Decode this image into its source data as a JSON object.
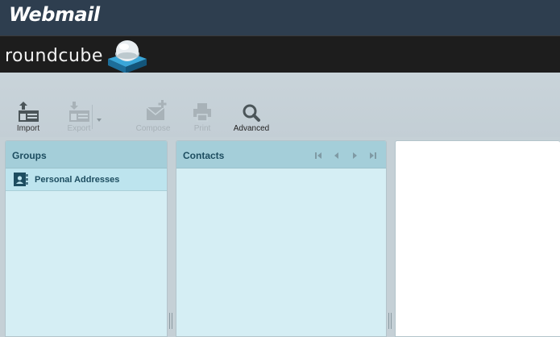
{
  "header": {
    "brand": "Webmail"
  },
  "logo": {
    "text": "roundcube"
  },
  "toolbar": {
    "import_label": "Import",
    "export_label": "Export",
    "compose_label": "Compose",
    "print_label": "Print",
    "advanced_label": "Advanced"
  },
  "groups": {
    "title": "Groups",
    "items": [
      {
        "label": "Personal Addresses"
      }
    ]
  },
  "contacts": {
    "title": "Contacts"
  },
  "icons": {
    "import": "import-icon",
    "export": "export-icon",
    "compose": "compose-icon",
    "print": "print-icon",
    "advanced": "magnifier-icon",
    "addressbook": "addressbook-icon",
    "first": "first-page-icon",
    "prev": "previous-page-icon",
    "next": "next-page-icon",
    "last": "last-page-icon"
  },
  "colors": {
    "topbar": "#2e3e4f",
    "logobar": "#1d1d1d",
    "panel_bg": "#d5eef4",
    "panel_header": "#a4ced9",
    "selected_row": "#bde4ee",
    "text_accent": "#1d4d60"
  }
}
